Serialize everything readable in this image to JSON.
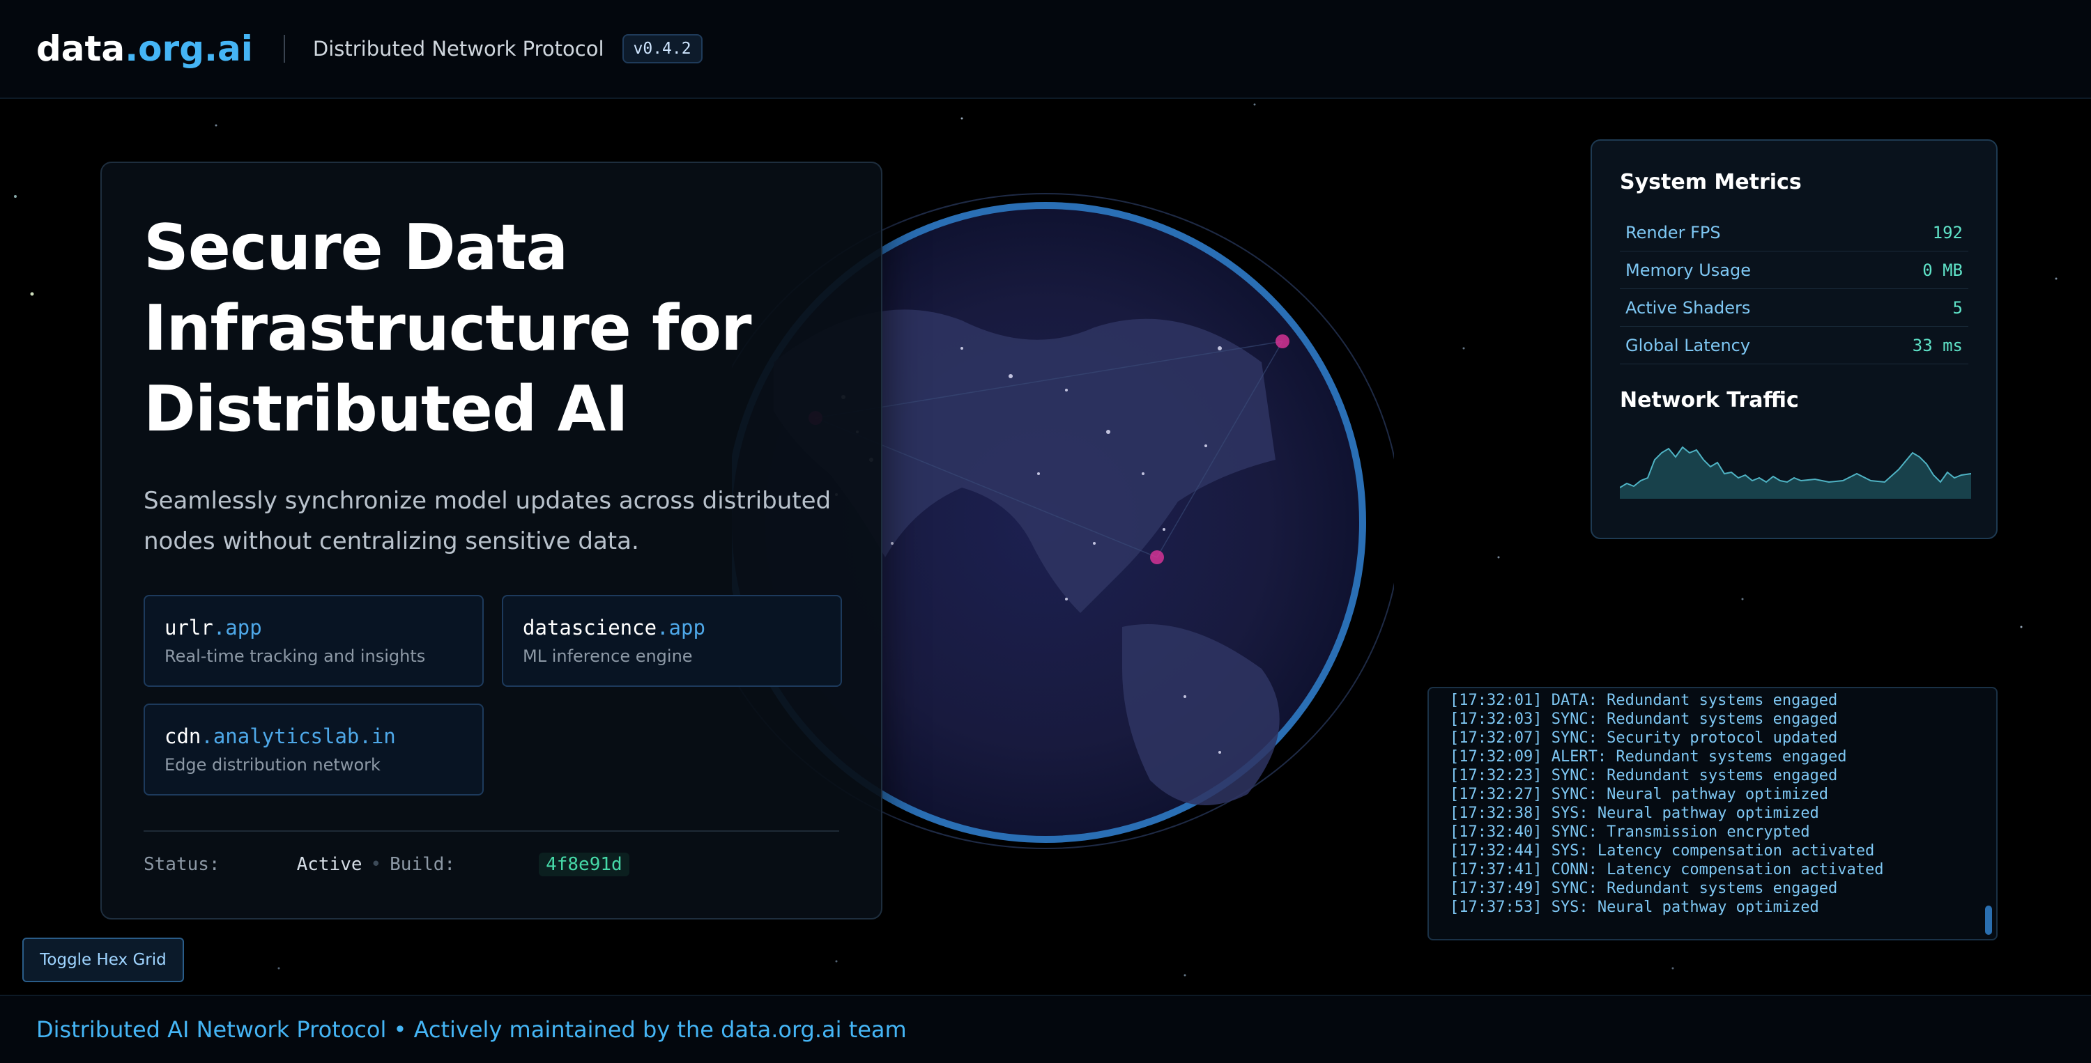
{
  "header": {
    "logo_main": "data",
    "logo_accent": ".org.ai",
    "subtitle": "Distributed Network Protocol",
    "version": "v0.4.2"
  },
  "hero": {
    "title": "Secure Data Infrastructure for Distributed AI",
    "description": "Seamlessly synchronize model updates across distributed nodes without centralizing sensitive data.",
    "cards": [
      {
        "title_main": "urlr",
        "title_accent": ".app",
        "desc": "Real-time tracking and insights"
      },
      {
        "title_main": "datascience",
        "title_accent": ".app",
        "desc": "ML inference engine"
      },
      {
        "title_main": "cdn",
        "title_accent": ".analyticslab.in",
        "desc": "Edge distribution network"
      }
    ],
    "status_label": "Status:",
    "status_value": "Active",
    "build_label": "Build:",
    "build_hash": "4f8e91d"
  },
  "metrics": {
    "title": "System Metrics",
    "rows": [
      {
        "label": "Render FPS",
        "value": "192"
      },
      {
        "label": "Memory Usage",
        "value": "0 MB"
      },
      {
        "label": "Active Shaders",
        "value": "5"
      },
      {
        "label": "Global Latency",
        "value": "33 ms"
      }
    ],
    "traffic_title": "Network Traffic",
    "traffic_color": "#4fb3c4"
  },
  "logs": [
    "[17:32:01] DATA: Redundant systems engaged",
    "[17:32:03] SYNC: Redundant systems engaged",
    "[17:32:07] SYNC: Security protocol updated",
    "[17:32:09] ALERT: Redundant systems engaged",
    "[17:32:23] SYNC: Redundant systems engaged",
    "[17:32:27] SYNC: Neural pathway optimized",
    "[17:32:38] SYS: Neural pathway optimized",
    "[17:32:40] SYNC: Transmission encrypted",
    "[17:32:44] SYS: Latency compensation activated",
    "[17:37:41] CONN: Latency compensation activated",
    "[17:37:49] SYNC: Redundant systems engaged",
    "[17:37:53] SYS: Neural pathway optimized"
  ],
  "toggle_button": "Toggle Hex Grid",
  "footer": "Distributed AI Network Protocol • Actively maintained by the data.org.ai team",
  "colors": {
    "accent": "#45b5f5",
    "metric_value": "#5fe3c8",
    "node_highlight": "#e0359a"
  }
}
